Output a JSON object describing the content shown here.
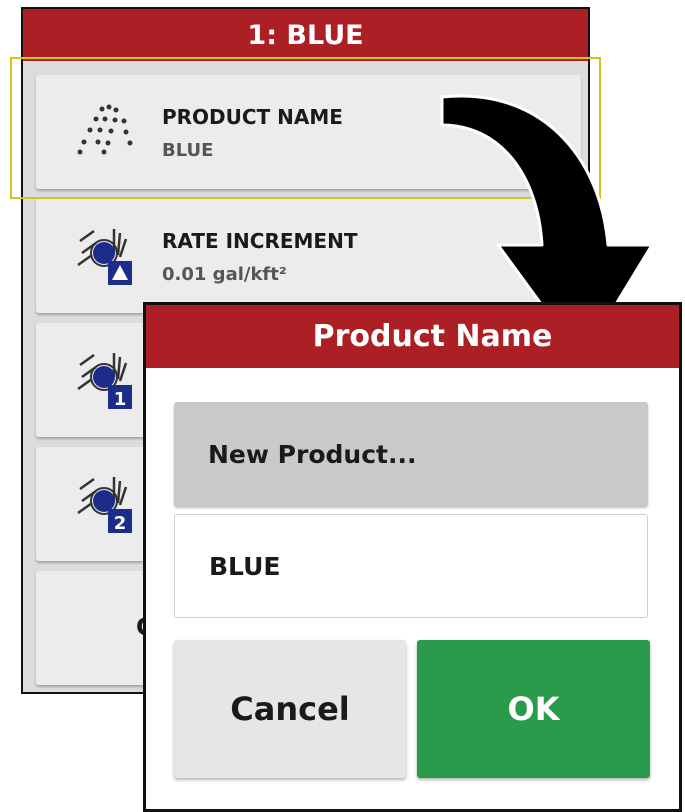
{
  "panel": {
    "title": "1: BLUE",
    "items": [
      {
        "label": "PRODUCT NAME",
        "value": "BLUE",
        "icon": "spray-droplets-icon"
      },
      {
        "label": "RATE INCREMENT",
        "value": "0.01 gal/kft²",
        "icon": "rate-increment-icon"
      },
      {
        "label": "",
        "value": "",
        "icon": "rate-preset-1-icon",
        "badge": "1"
      },
      {
        "label": "",
        "value": "",
        "icon": "rate-preset-2-icon",
        "badge": "2"
      },
      {
        "label": "Ca",
        "value": ""
      }
    ]
  },
  "dialog": {
    "title": "Product Name",
    "option_label": "New Product...",
    "input_value": "BLUE",
    "cancel_label": "Cancel",
    "ok_label": "OK"
  },
  "colors": {
    "header_red": "#ac1f24",
    "ok_green": "#2a9b4a",
    "highlight_yellow": "#d8c11a",
    "badge_navy": "#1d2c8a"
  }
}
